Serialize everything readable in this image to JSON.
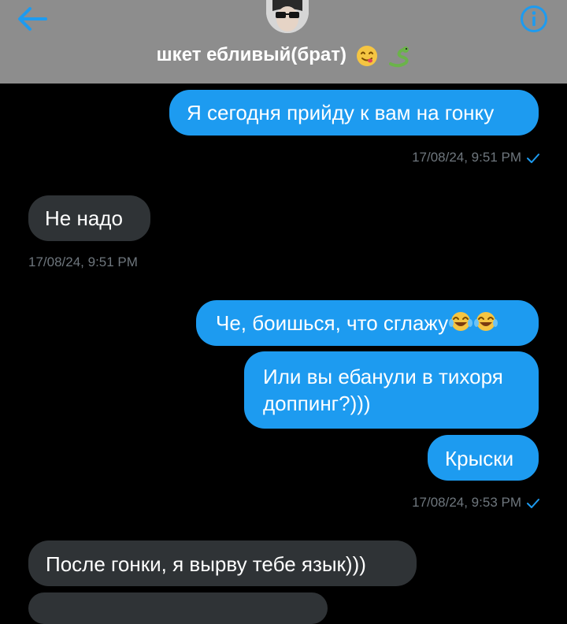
{
  "header": {
    "contact_name": "шкет ебливый(брат)",
    "back_icon": "arrow-left-icon",
    "info_icon": "info-icon",
    "avatar": "contact-avatar",
    "name_emojis": [
      "yum-face-emoji",
      "snake-emoji"
    ]
  },
  "colors": {
    "accent": "#1d9bf0",
    "incoming_bubble": "#2f3336",
    "header_bg": "#8d8d8d",
    "timestamp": "#6e767d"
  },
  "messages": [
    {
      "direction": "outgoing",
      "text": "Я сегодня прийду к вам на гонку"
    },
    {
      "direction": "outgoing",
      "timestamp": "17/08/24, 9:51 PM",
      "read": true
    },
    {
      "direction": "incoming",
      "text": "Не надо"
    },
    {
      "direction": "incoming",
      "timestamp": "17/08/24, 9:51 PM"
    },
    {
      "direction": "outgoing",
      "text": "Че, боишься, что сглажу",
      "emoji": "tears-of-joy-emoji"
    },
    {
      "direction": "outgoing",
      "text_line1": "Или вы ебанули в тихоря",
      "text_line2": "доппинг?)))"
    },
    {
      "direction": "outgoing",
      "text": "Крыски"
    },
    {
      "direction": "outgoing",
      "timestamp": "17/08/24, 9:53 PM",
      "read": true
    },
    {
      "direction": "incoming",
      "text": "После гонки, я вырву тебе язык)))"
    }
  ]
}
